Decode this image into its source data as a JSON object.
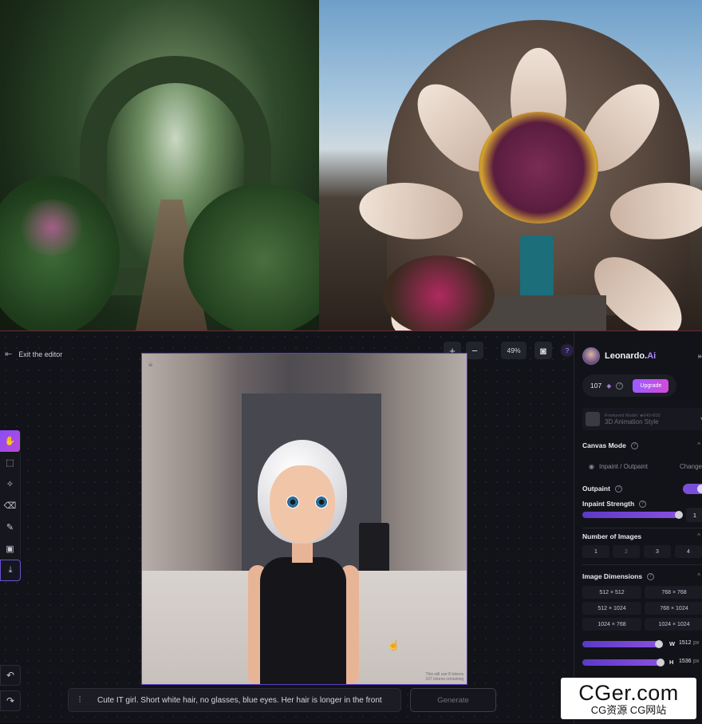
{
  "editor": {
    "exit_label": "Exit the editor",
    "zoom": {
      "plus": "+",
      "minus": "−",
      "value": "49%"
    },
    "help": "?",
    "prompt_value": "Cute IT girl. Short white hair, no glasses, blue eyes. Her hair is longer in the front",
    "generate_label": "Generate",
    "tokens_note": "This will use 8 tokens. 107 tokens remaining."
  },
  "sidebar": {
    "brand": "Leonardo.",
    "brand_ai": "Ai",
    "tokens_count": "107",
    "upgrade_label": "Upgrade",
    "model_tag": "Finetuned Model",
    "model_size": "640×832",
    "model_name": "3D Animation Style",
    "canvas_mode_label": "Canvas Mode",
    "inpaint_mode_label": "Inpaint / Outpaint",
    "change_label": "Change",
    "outpaint_label": "Outpaint",
    "inpaint_strength_label": "Inpaint Strength",
    "inpaint_strength_value": "1",
    "inpaint_strength_fraction": 1.0,
    "number_images_label": "Number of Images",
    "number_images_options": [
      "1",
      "2",
      "3",
      "4"
    ],
    "image_dimensions_label": "Image Dimensions",
    "dimension_options": [
      "512 × 512",
      "768 × 768",
      "512 × 1024",
      "768 × 1024",
      "1024 × 768",
      "1024 × 1024"
    ],
    "width_label": "W",
    "width_value": "1512",
    "height_label": "H",
    "height_value": "1536",
    "unit": "px"
  },
  "watermark": {
    "line1": "CGer.com",
    "line2": "CG资源 CG网站"
  },
  "colors": {
    "accent": "#8a4cf5",
    "accent2": "#d14bd8",
    "background": "#121319"
  }
}
